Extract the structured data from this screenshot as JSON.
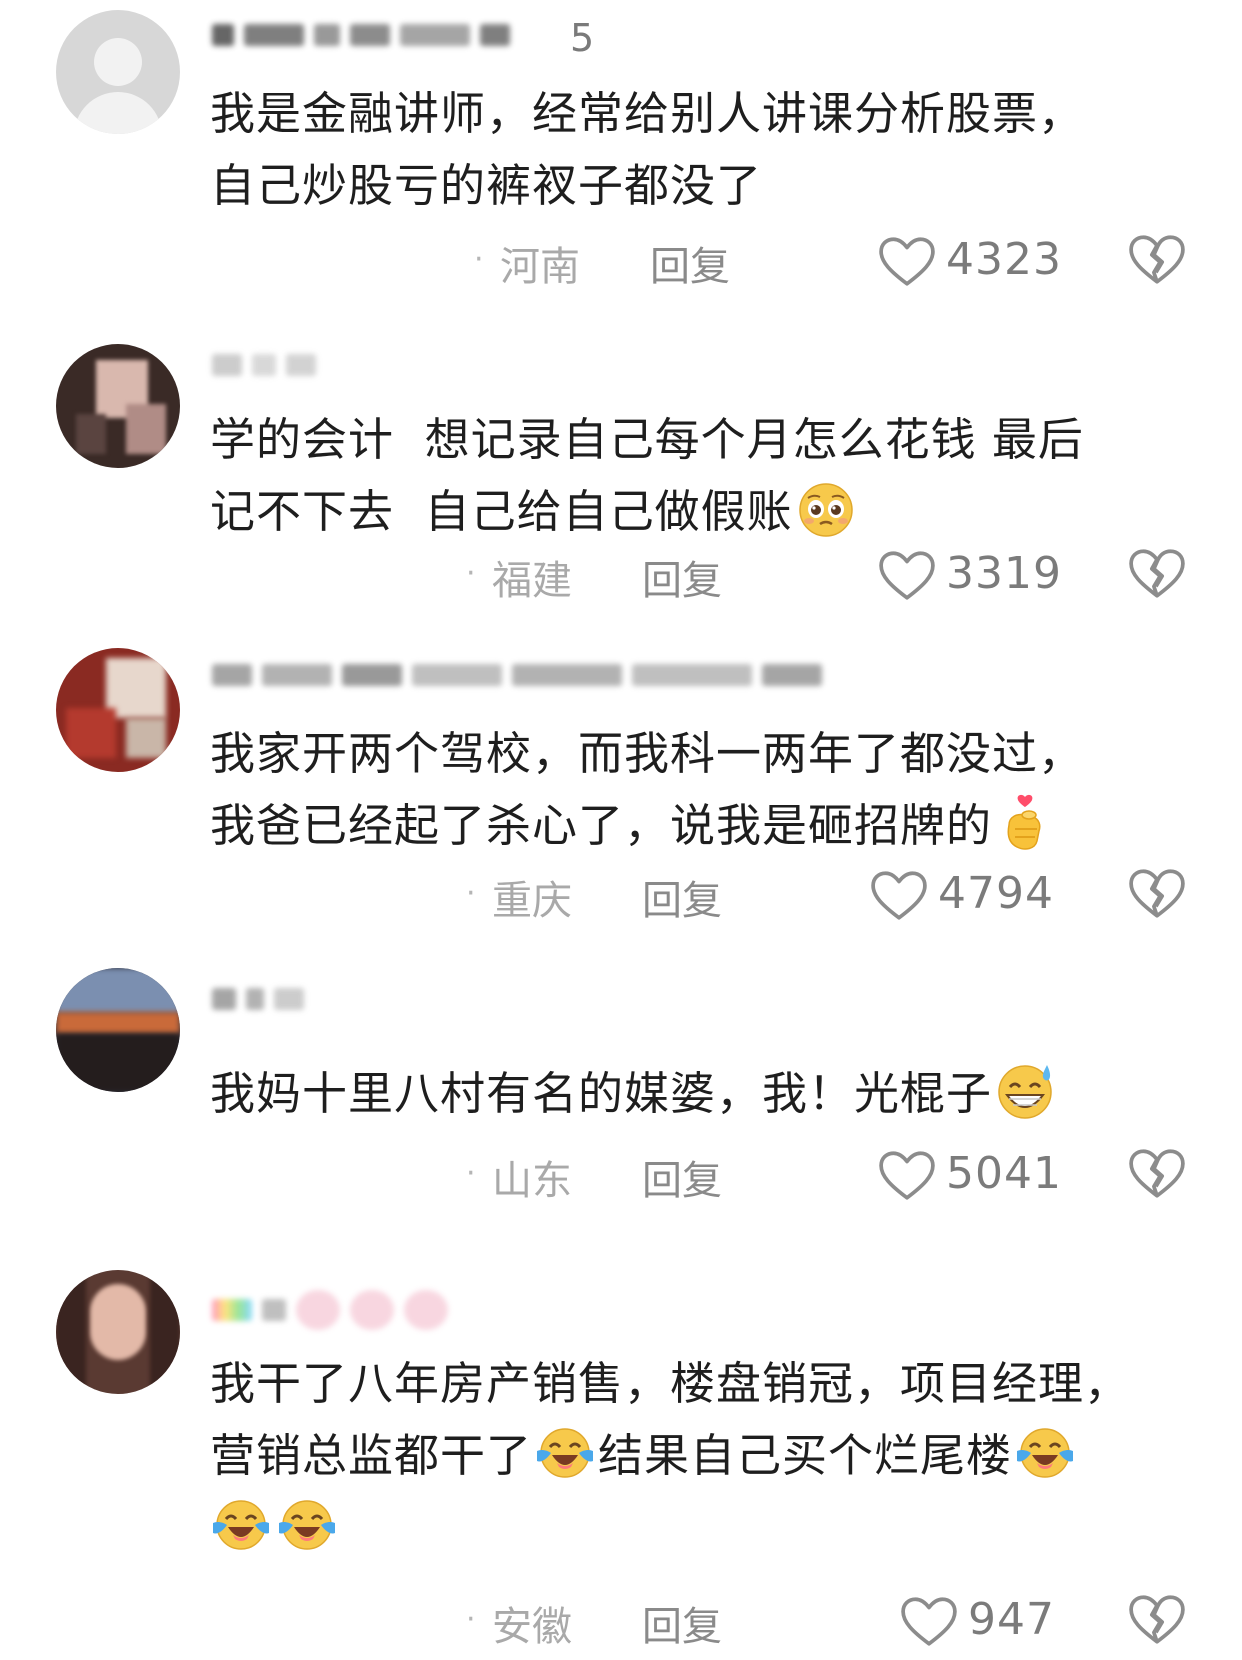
{
  "comments": [
    {
      "username_visible": "5",
      "text": "我是金融讲师，经常给别人讲课分析股票，\n自己炒股亏的裤衩子都没了",
      "emojis": [],
      "location": "河南",
      "reply": "回复",
      "likes": "4323"
    },
    {
      "username_visible": "",
      "text": "学的会计  想记录自己每个月怎么花钱 最后\n记不下去  自己给自己做假账",
      "emojis": [
        "pleading-face"
      ],
      "location": "福建",
      "reply": "回复",
      "likes": "3319"
    },
    {
      "username_visible": "",
      "text": "我家开两个驾校，而我科一两年了都没过，\n我爸已经起了杀心了，说我是砸招牌的",
      "emojis": [
        "finger-heart"
      ],
      "location": "重庆",
      "reply": "回复",
      "likes": "4794"
    },
    {
      "username_visible": "",
      "text": "我妈十里八村有名的媒婆，我！光棍子",
      "emojis": [
        "grinning-sweat"
      ],
      "location": "山东",
      "reply": "回复",
      "likes": "5041"
    },
    {
      "username_visible": "",
      "text_part1": "我干了八年房产销售，楼盘销冠，项目经理，",
      "text_part2": "营销总监都干了",
      "text_part3": "结果自己买个烂尾楼",
      "emojis": [
        "crying-laughing",
        "crying-laughing",
        "crying-laughing",
        "crying-laughing"
      ],
      "location": "安徽",
      "reply": "回复",
      "likes": "947"
    }
  ],
  "colors": {
    "text": "#1e1e1e",
    "meta": "#a9a9a9",
    "reply": "#8a8a8a",
    "like_count": "#7b7b7b",
    "emoji_yellow": "#f7c531"
  }
}
